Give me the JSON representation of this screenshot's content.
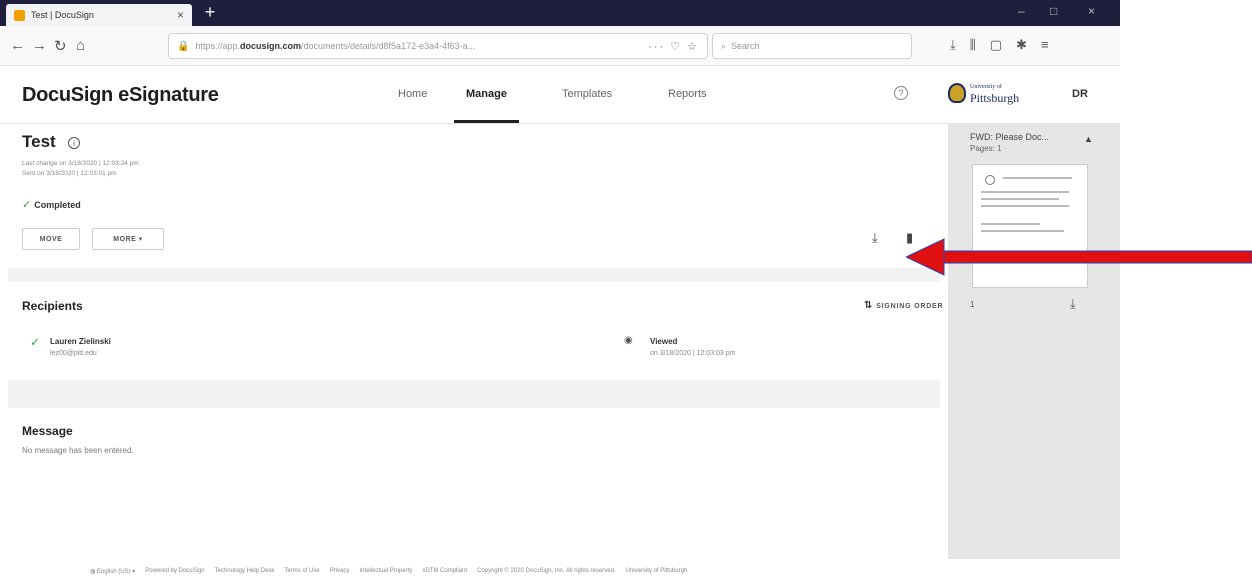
{
  "browser": {
    "tab_title": "Test | DocuSign",
    "tab_close": "×",
    "new_tab": "+",
    "url_domain": "docusign.com",
    "url_prefix": "https://app.",
    "url_suffix": "/documents/details/d8f5a172-e3a4-4f63-a...",
    "url_end_icons": "··· ♡ ☆",
    "search_placeholder": "Search",
    "win_min": "–",
    "win_max": "□",
    "win_close": "×"
  },
  "header": {
    "brand": "DocuSign eSignature",
    "nav": [
      "Home",
      "Manage",
      "Templates",
      "Reports"
    ],
    "help": "?",
    "org_name": "Pittsburgh",
    "org_prefix": "University of",
    "avatar": "DR"
  },
  "envelope": {
    "title": "Test",
    "last_change": "Last change on 3/18/2020 | 12:03:24 pm",
    "sent_on": "Sent on 3/18/2020 | 12:03:01 pm",
    "status": "Completed",
    "buttons": {
      "move": "MOVE",
      "more": "MORE ▾"
    }
  },
  "recipients": {
    "heading": "Recipients",
    "signing_order": "SIGNING ORDER",
    "items": [
      {
        "name": "Lauren Zielinski",
        "email": "lez00@pitt.edu",
        "status": "Viewed",
        "status_time": "on 3/18/2020 | 12:03:03 pm"
      }
    ]
  },
  "message": {
    "heading": "Message",
    "body": "No message has been entered."
  },
  "document_panel": {
    "title": "FWD: Please Doc...",
    "pages": "Pages: 1",
    "page_number": "1"
  },
  "footer": {
    "language": "English (US) ▾",
    "links": [
      "Powered by DocuSign",
      "Technology Help Desk",
      "Terms of Use",
      "Privacy",
      "Intellectual Property",
      "xDTM Compliant",
      "Copyright © 2020 DocuSign, Inc. All rights reserved.",
      "University of Pittsburgh"
    ]
  },
  "colors": {
    "annotation_arrow": "#e01010",
    "completed_check": "#3aa04a",
    "tab_bar": "#1f1f3d"
  }
}
